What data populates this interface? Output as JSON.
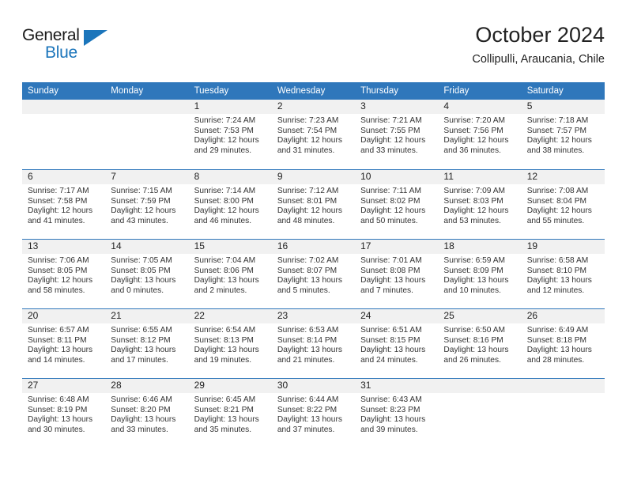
{
  "brand": {
    "name_top": "General",
    "name_bottom": "Blue",
    "accent_color": "#1b75bb"
  },
  "header": {
    "title": "October 2024",
    "subtitle": "Collipulli, Araucania, Chile"
  },
  "theme": {
    "header_row_bg": "#2f77bb",
    "header_row_text": "#ffffff",
    "day_number_band_bg": "#f1f1f1",
    "week_separator": "#2f77bb",
    "body_text": "#333333"
  },
  "calendar": {
    "weekdays": [
      "Sunday",
      "Monday",
      "Tuesday",
      "Wednesday",
      "Thursday",
      "Friday",
      "Saturday"
    ],
    "weeks": [
      [
        {
          "day": "",
          "empty": true
        },
        {
          "day": "",
          "empty": true
        },
        {
          "day": "1",
          "sunrise": "Sunrise: 7:24 AM",
          "sunset": "Sunset: 7:53 PM",
          "daylight": "Daylight: 12 hours and 29 minutes."
        },
        {
          "day": "2",
          "sunrise": "Sunrise: 7:23 AM",
          "sunset": "Sunset: 7:54 PM",
          "daylight": "Daylight: 12 hours and 31 minutes."
        },
        {
          "day": "3",
          "sunrise": "Sunrise: 7:21 AM",
          "sunset": "Sunset: 7:55 PM",
          "daylight": "Daylight: 12 hours and 33 minutes."
        },
        {
          "day": "4",
          "sunrise": "Sunrise: 7:20 AM",
          "sunset": "Sunset: 7:56 PM",
          "daylight": "Daylight: 12 hours and 36 minutes."
        },
        {
          "day": "5",
          "sunrise": "Sunrise: 7:18 AM",
          "sunset": "Sunset: 7:57 PM",
          "daylight": "Daylight: 12 hours and 38 minutes."
        }
      ],
      [
        {
          "day": "6",
          "sunrise": "Sunrise: 7:17 AM",
          "sunset": "Sunset: 7:58 PM",
          "daylight": "Daylight: 12 hours and 41 minutes."
        },
        {
          "day": "7",
          "sunrise": "Sunrise: 7:15 AM",
          "sunset": "Sunset: 7:59 PM",
          "daylight": "Daylight: 12 hours and 43 minutes."
        },
        {
          "day": "8",
          "sunrise": "Sunrise: 7:14 AM",
          "sunset": "Sunset: 8:00 PM",
          "daylight": "Daylight: 12 hours and 46 minutes."
        },
        {
          "day": "9",
          "sunrise": "Sunrise: 7:12 AM",
          "sunset": "Sunset: 8:01 PM",
          "daylight": "Daylight: 12 hours and 48 minutes."
        },
        {
          "day": "10",
          "sunrise": "Sunrise: 7:11 AM",
          "sunset": "Sunset: 8:02 PM",
          "daylight": "Daylight: 12 hours and 50 minutes."
        },
        {
          "day": "11",
          "sunrise": "Sunrise: 7:09 AM",
          "sunset": "Sunset: 8:03 PM",
          "daylight": "Daylight: 12 hours and 53 minutes."
        },
        {
          "day": "12",
          "sunrise": "Sunrise: 7:08 AM",
          "sunset": "Sunset: 8:04 PM",
          "daylight": "Daylight: 12 hours and 55 minutes."
        }
      ],
      [
        {
          "day": "13",
          "sunrise": "Sunrise: 7:06 AM",
          "sunset": "Sunset: 8:05 PM",
          "daylight": "Daylight: 12 hours and 58 minutes."
        },
        {
          "day": "14",
          "sunrise": "Sunrise: 7:05 AM",
          "sunset": "Sunset: 8:05 PM",
          "daylight": "Daylight: 13 hours and 0 minutes."
        },
        {
          "day": "15",
          "sunrise": "Sunrise: 7:04 AM",
          "sunset": "Sunset: 8:06 PM",
          "daylight": "Daylight: 13 hours and 2 minutes."
        },
        {
          "day": "16",
          "sunrise": "Sunrise: 7:02 AM",
          "sunset": "Sunset: 8:07 PM",
          "daylight": "Daylight: 13 hours and 5 minutes."
        },
        {
          "day": "17",
          "sunrise": "Sunrise: 7:01 AM",
          "sunset": "Sunset: 8:08 PM",
          "daylight": "Daylight: 13 hours and 7 minutes."
        },
        {
          "day": "18",
          "sunrise": "Sunrise: 6:59 AM",
          "sunset": "Sunset: 8:09 PM",
          "daylight": "Daylight: 13 hours and 10 minutes."
        },
        {
          "day": "19",
          "sunrise": "Sunrise: 6:58 AM",
          "sunset": "Sunset: 8:10 PM",
          "daylight": "Daylight: 13 hours and 12 minutes."
        }
      ],
      [
        {
          "day": "20",
          "sunrise": "Sunrise: 6:57 AM",
          "sunset": "Sunset: 8:11 PM",
          "daylight": "Daylight: 13 hours and 14 minutes."
        },
        {
          "day": "21",
          "sunrise": "Sunrise: 6:55 AM",
          "sunset": "Sunset: 8:12 PM",
          "daylight": "Daylight: 13 hours and 17 minutes."
        },
        {
          "day": "22",
          "sunrise": "Sunrise: 6:54 AM",
          "sunset": "Sunset: 8:13 PM",
          "daylight": "Daylight: 13 hours and 19 minutes."
        },
        {
          "day": "23",
          "sunrise": "Sunrise: 6:53 AM",
          "sunset": "Sunset: 8:14 PM",
          "daylight": "Daylight: 13 hours and 21 minutes."
        },
        {
          "day": "24",
          "sunrise": "Sunrise: 6:51 AM",
          "sunset": "Sunset: 8:15 PM",
          "daylight": "Daylight: 13 hours and 24 minutes."
        },
        {
          "day": "25",
          "sunrise": "Sunrise: 6:50 AM",
          "sunset": "Sunset: 8:16 PM",
          "daylight": "Daylight: 13 hours and 26 minutes."
        },
        {
          "day": "26",
          "sunrise": "Sunrise: 6:49 AM",
          "sunset": "Sunset: 8:18 PM",
          "daylight": "Daylight: 13 hours and 28 minutes."
        }
      ],
      [
        {
          "day": "27",
          "sunrise": "Sunrise: 6:48 AM",
          "sunset": "Sunset: 8:19 PM",
          "daylight": "Daylight: 13 hours and 30 minutes."
        },
        {
          "day": "28",
          "sunrise": "Sunrise: 6:46 AM",
          "sunset": "Sunset: 8:20 PM",
          "daylight": "Daylight: 13 hours and 33 minutes."
        },
        {
          "day": "29",
          "sunrise": "Sunrise: 6:45 AM",
          "sunset": "Sunset: 8:21 PM",
          "daylight": "Daylight: 13 hours and 35 minutes."
        },
        {
          "day": "30",
          "sunrise": "Sunrise: 6:44 AM",
          "sunset": "Sunset: 8:22 PM",
          "daylight": "Daylight: 13 hours and 37 minutes."
        },
        {
          "day": "31",
          "sunrise": "Sunrise: 6:43 AM",
          "sunset": "Sunset: 8:23 PM",
          "daylight": "Daylight: 13 hours and 39 minutes."
        },
        {
          "day": "",
          "empty": true
        },
        {
          "day": "",
          "empty": true
        }
      ]
    ]
  }
}
